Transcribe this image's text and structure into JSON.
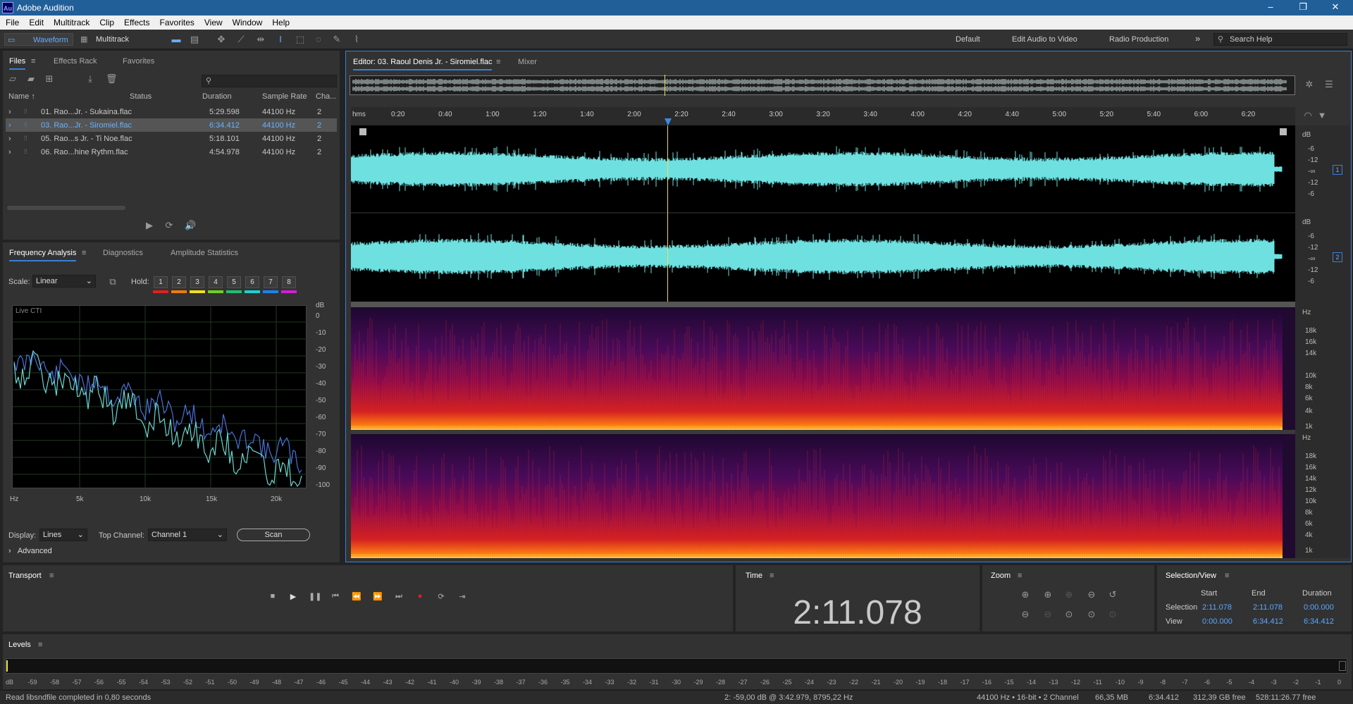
{
  "app": {
    "title": "Adobe Audition",
    "logo": "Au"
  },
  "window_controls": [
    "–",
    "❐",
    "✕"
  ],
  "menu": [
    "File",
    "Edit",
    "Multitrack",
    "Clip",
    "Effects",
    "Favorites",
    "View",
    "Window",
    "Help"
  ],
  "toolbar": {
    "waveform_label": "Waveform",
    "multitrack_label": "Multitrack",
    "workspaces": [
      "Default",
      "Edit Audio to Video",
      "Radio Production"
    ],
    "more": "»",
    "search_placeholder": "Search Help"
  },
  "files_panel": {
    "tabs": [
      "Files",
      "Effects Rack",
      "Favorites"
    ],
    "columns": [
      "Name",
      "Status",
      "Duration",
      "Sample Rate",
      "Cha..."
    ],
    "files": [
      {
        "name": "01. Rao...Jr. - Sukaina.flac",
        "duration": "5:29.598",
        "rate": "44100 Hz",
        "channels": "2"
      },
      {
        "name": "03. Rao...Jr. - Siromiel.flac",
        "duration": "6:34.412",
        "rate": "44100 Hz",
        "channels": "2"
      },
      {
        "name": "05. Rao...s Jr. - Ti Noe.flac",
        "duration": "5:18.101",
        "rate": "44100 Hz",
        "channels": "2"
      },
      {
        "name": "06. Rao...hine Rythm.flac",
        "duration": "4:54.978",
        "rate": "44100 Hz",
        "channels": "2"
      }
    ],
    "selected_index": 1
  },
  "freq_panel": {
    "tabs": [
      "Frequency Analysis",
      "Diagnostics",
      "Amplitude Statistics"
    ],
    "scale_label": "Scale:",
    "scale_value": "Linear",
    "hold_label": "Hold:",
    "hold_buttons": [
      "1",
      "2",
      "3",
      "4",
      "5",
      "6",
      "7",
      "8"
    ],
    "hold_colors": [
      "#e02020",
      "#f07a10",
      "#f0e020",
      "#70d020",
      "#20c070",
      "#20d0d0",
      "#2080f0",
      "#d020d0"
    ],
    "graph_label": "Live CTI",
    "db_unit": "dB",
    "db_ticks": [
      "0",
      "-10",
      "-20",
      "-30",
      "-40",
      "-50",
      "-60",
      "-70",
      "-80",
      "-90",
      "-100"
    ],
    "hz_ticks": [
      "Hz",
      "5k",
      "10k",
      "15k",
      "20k"
    ],
    "display_label": "Display:",
    "display_value": "Lines",
    "top_channel_label": "Top Channel:",
    "top_channel_value": "Channel 1",
    "scan_label": "Scan",
    "advanced_label": "Advanced"
  },
  "editor": {
    "tab_label": "Editor: 03. Raoul Denis Jr. - Siromiel.flac",
    "mixer_label": "Mixer",
    "timeline_unit": "hms",
    "timeline_ticks": [
      "0:20",
      "0:40",
      "1:00",
      "1:20",
      "1:40",
      "2:00",
      "2:20",
      "2:40",
      "3:00",
      "3:20",
      "3:40",
      "4:00",
      "4:20",
      "4:40",
      "5:00",
      "5:20",
      "5:40",
      "6:00",
      "6:20"
    ],
    "duration_seconds": 394.412,
    "playhead_seconds": 131.078,
    "wave_ruler": [
      "dB",
      "-6",
      "-12",
      "-∞",
      "-12",
      "-6"
    ],
    "channel_badges": [
      "1",
      "2"
    ],
    "spec_ruler": [
      "Hz",
      "18k",
      "16k",
      "14k",
      "10k",
      "8k",
      "6k",
      "4k",
      "1k"
    ],
    "spec_ruler2": [
      "Hz",
      "18k",
      "16k",
      "14k",
      "12k",
      "10k",
      "8k",
      "6k",
      "4k",
      "1k"
    ]
  },
  "transport": {
    "title": "Transport"
  },
  "time": {
    "title": "Time",
    "value": "2:11.078"
  },
  "zoom": {
    "title": "Zoom"
  },
  "selection": {
    "title": "Selection/View",
    "headers": [
      "Start",
      "End",
      "Duration"
    ],
    "rows": [
      {
        "label": "Selection",
        "start": "2:11.078",
        "end": "2:11.078",
        "duration": "0:00.000"
      },
      {
        "label": "View",
        "start": "0:00.000",
        "end": "6:34.412",
        "duration": "6:34.412"
      }
    ]
  },
  "levels": {
    "title": "Levels",
    "ticks": [
      "dB",
      "-59",
      "-58",
      "-57",
      "-56",
      "-55",
      "-54",
      "-53",
      "-52",
      "-51",
      "-50",
      "-49",
      "-48",
      "-47",
      "-46",
      "-45",
      "-44",
      "-43",
      "-42",
      "-41",
      "-40",
      "-39",
      "-38",
      "-37",
      "-36",
      "-35",
      "-34",
      "-33",
      "-32",
      "-31",
      "-30",
      "-29",
      "-28",
      "-27",
      "-26",
      "-25",
      "-24",
      "-23",
      "-22",
      "-21",
      "-20",
      "-19",
      "-18",
      "-17",
      "-16",
      "-15",
      "-14",
      "-13",
      "-12",
      "-11",
      "-10",
      "-9",
      "-8",
      "-7",
      "-6",
      "-5",
      "-4",
      "-3",
      "-2",
      "-1",
      "0"
    ]
  },
  "status": {
    "left": "Read libsndfile completed in 0,80 seconds",
    "cursor": "2: -59,00 dB @ 3:42.979, 8795,22 Hz",
    "format": "44100 Hz • 16-bit • 2 Channel",
    "size": "66,35 MB",
    "duration": "6:34.412",
    "free": "312,39 GB free",
    "free_time": "528:11:26.77 free"
  },
  "colors": {
    "waveform": "#6ee0e0",
    "accent": "#3a7ed8",
    "playhead": "#e8e060",
    "title_bar": "#215f99"
  }
}
